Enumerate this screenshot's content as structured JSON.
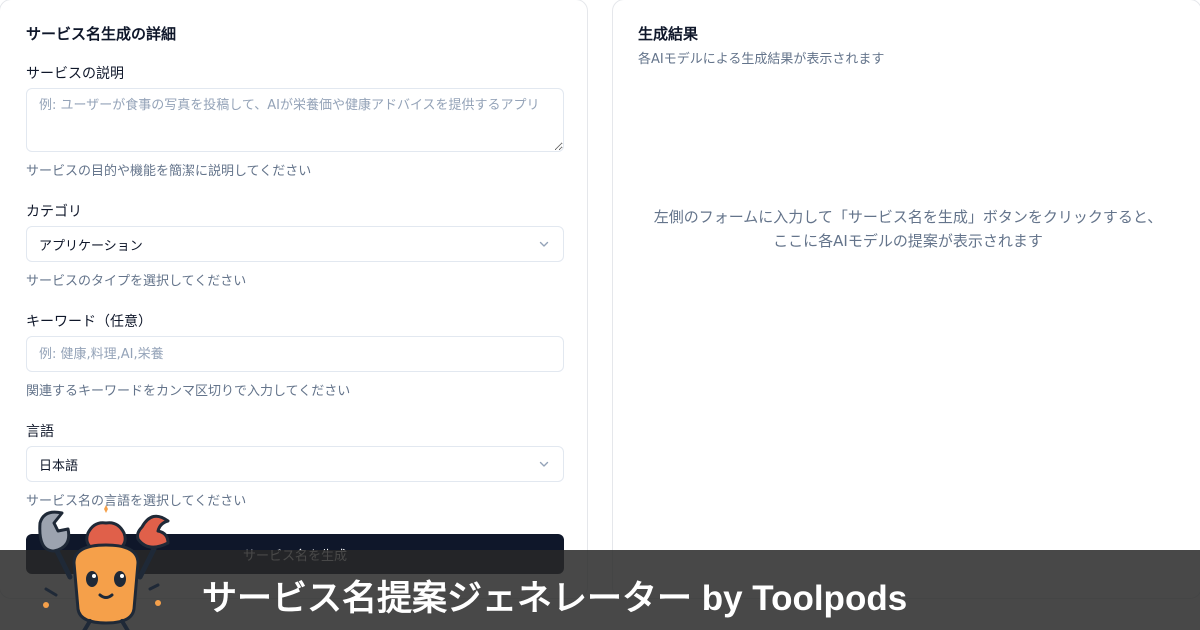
{
  "form": {
    "title": "サービス名生成の詳細",
    "description": {
      "label": "サービスの説明",
      "placeholder": "例: ユーザーが食事の写真を投稿して、AIが栄養価や健康アドバイスを提供するアプリ",
      "hint": "サービスの目的や機能を簡潔に説明してください"
    },
    "category": {
      "label": "カテゴリ",
      "value": "アプリケーション",
      "hint": "サービスのタイプを選択してください",
      "icon": "chevron-down-icon"
    },
    "keywords": {
      "label": "キーワード（任意）",
      "placeholder": "例: 健康,料理,AI,栄養",
      "hint": "関連するキーワードをカンマ区切りで入力してください"
    },
    "language": {
      "label": "言語",
      "value": "日本語",
      "hint": "サービス名の言語を選択してください",
      "icon": "chevron-down-icon"
    },
    "submit_label": "サービス名を生成"
  },
  "results": {
    "title": "生成結果",
    "subtitle": "各AIモデルによる生成結果が表示されます",
    "empty_line1": "左側のフォームに入力して「サービス名を生成」ボタンをクリックすると、",
    "empty_line2": "ここに各AIモデルの提案が表示されます"
  },
  "banner": {
    "title": "サービス名提案ジェネレーター by Toolpods",
    "mascot_icon": "crab-robot-mascot-icon"
  },
  "colors": {
    "primary": "#0f172a",
    "muted": "#64748b",
    "border": "#e2e8f0",
    "banner": "#282828",
    "mascot_body": "#f5a04a",
    "mascot_claw": "#e0604a"
  }
}
